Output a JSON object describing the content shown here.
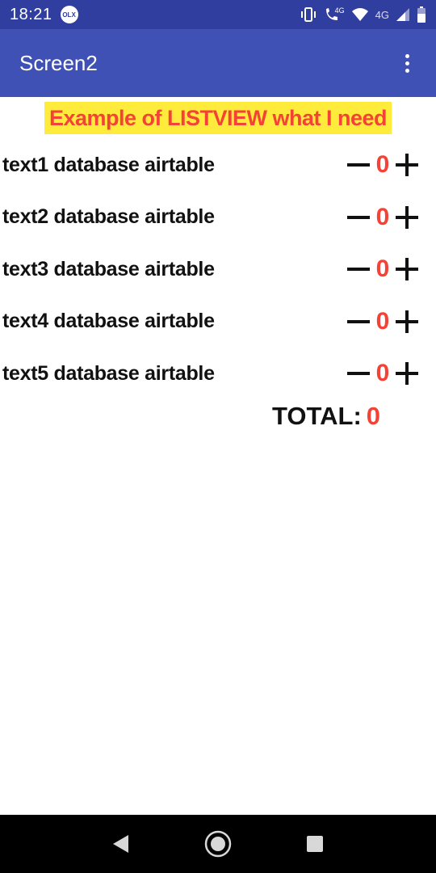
{
  "status_bar": {
    "time": "18:21",
    "notification_icon": "olx-icon",
    "notification_text": "OLX",
    "network_label_1": "4G",
    "network_label_2": "4G"
  },
  "app_bar": {
    "title": "Screen2",
    "menu_icon": "overflow-menu-icon"
  },
  "heading": "Example of LISTVIEW what I need",
  "items": [
    {
      "label": "text1 database airtable",
      "quantity": "0"
    },
    {
      "label": "text2 database airtable",
      "quantity": "0"
    },
    {
      "label": "text3 database airtable",
      "quantity": "0"
    },
    {
      "label": "text4 database airtable",
      "quantity": "0"
    },
    {
      "label": "text5 database airtable",
      "quantity": "0"
    }
  ],
  "total": {
    "label": "TOTAL:",
    "value": "0"
  },
  "colors": {
    "status_bar": "#303f9f",
    "app_bar": "#3f51b5",
    "accent_red": "#f44336",
    "highlight_yellow": "#ffeb3b"
  },
  "nav_bar": {
    "icons": [
      "back-icon",
      "home-icon",
      "recents-icon"
    ]
  }
}
